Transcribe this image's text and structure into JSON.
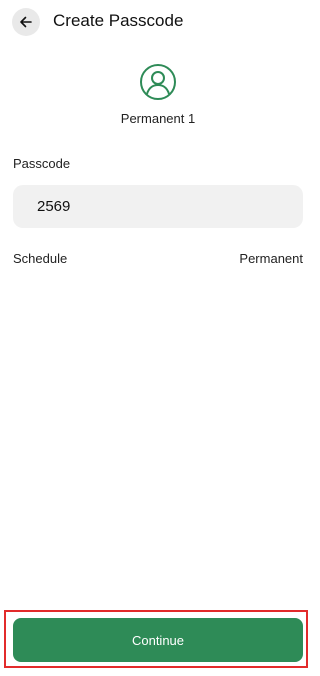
{
  "header": {
    "title": "Create Passcode",
    "back_icon": "arrow-left-icon"
  },
  "profile": {
    "avatar_icon": "user-circle-icon",
    "name": "Permanent 1",
    "accent_color": "#2e8b57"
  },
  "form": {
    "passcode_label": "Passcode",
    "passcode_value": "2569",
    "schedule_label": "Schedule",
    "schedule_value": "Permanent"
  },
  "footer": {
    "continue_label": "Continue",
    "button_color": "#2e8b57",
    "highlight_color": "#e22b2b"
  }
}
